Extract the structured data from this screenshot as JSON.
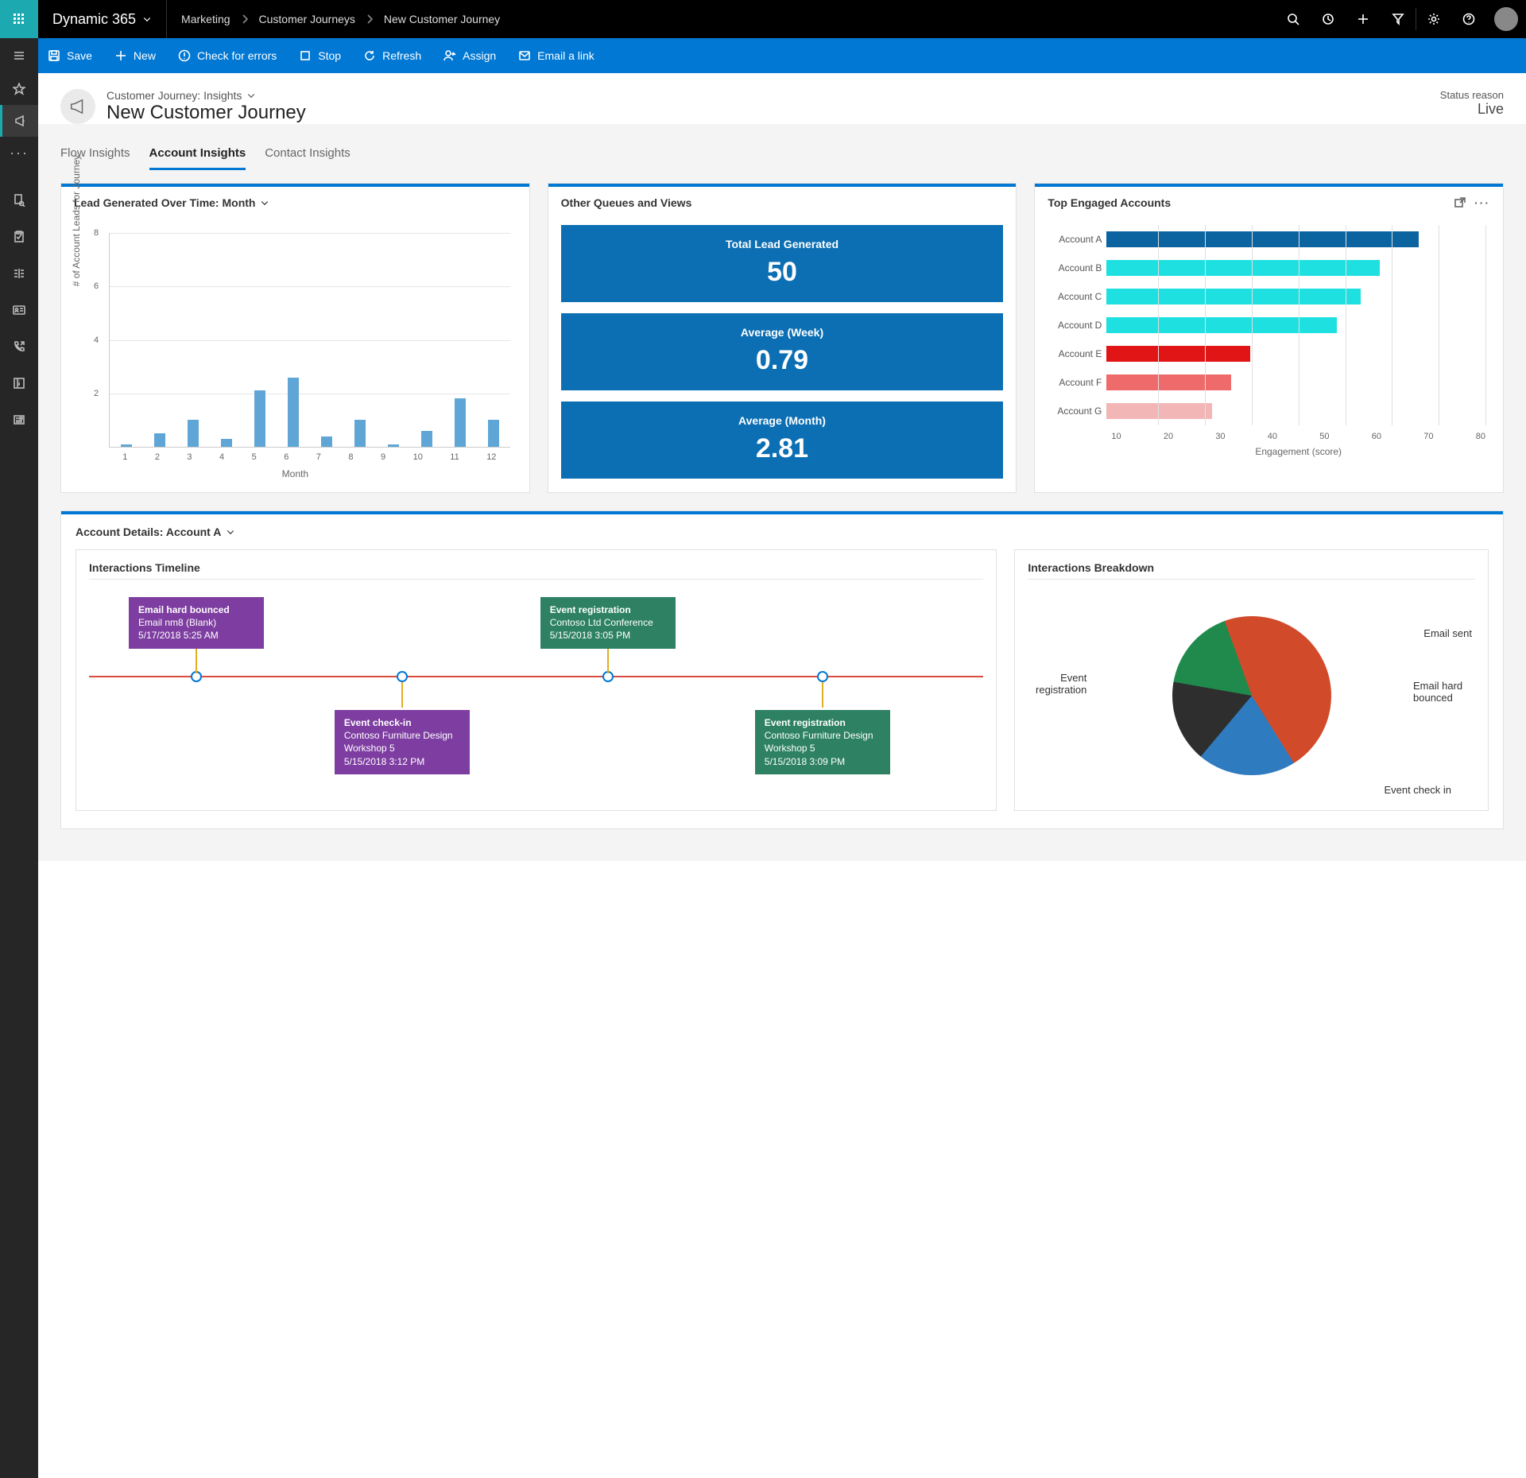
{
  "topbar": {
    "brand": "Dynamic 365",
    "breadcrumbs": [
      "Marketing",
      "Customer Journeys",
      "New Customer Journey"
    ]
  },
  "cmdbar": {
    "save": "Save",
    "new": "New",
    "check": "Check for errors",
    "stop": "Stop",
    "refresh": "Refresh",
    "assign": "Assign",
    "email": "Email a link"
  },
  "record": {
    "sub": "Customer Journey: Insights",
    "title": "New Customer Journey",
    "status_label": "Status reason",
    "status_value": "Live"
  },
  "tabs": {
    "flow": "Flow Insights",
    "account": "Account Insights",
    "contact": "Contact Insights"
  },
  "card1": {
    "title": "Lead Generated Over Time: Month",
    "ylabel": "# of Account Leads for Journey",
    "xlabel": "Month"
  },
  "card2": {
    "title": "Other Queues and Views",
    "kpis": [
      {
        "label": "Total Lead Generated",
        "value": "50"
      },
      {
        "label": "Average (Week)",
        "value": "0.79"
      },
      {
        "label": "Average (Month)",
        "value": "2.81"
      }
    ]
  },
  "card3": {
    "title": "Top Engaged Accounts",
    "xlabel": "Engagement (score)"
  },
  "details": {
    "title": "Account Details: Account A",
    "timeline_title": "Interactions Timeline",
    "breakdown_title": "Interactions Breakdown",
    "events": [
      {
        "pos": 12,
        "side": "up",
        "color": "purple",
        "title": "Email hard bounced",
        "line2": "Email nm8 (Blank)",
        "ts": "5/17/2018 5:25 AM"
      },
      {
        "pos": 35,
        "side": "down",
        "color": "purple",
        "title": "Event check-in",
        "line2": "Contoso Furniture Design Workshop 5",
        "ts": "5/15/2018 3:12 PM"
      },
      {
        "pos": 58,
        "side": "up",
        "color": "green",
        "title": "Event registration",
        "line2": "Contoso Ltd Conference",
        "ts": "5/15/2018 3:05 PM"
      },
      {
        "pos": 82,
        "side": "down",
        "color": "green",
        "title": "Event registration",
        "line2": "Contoso Furniture Design Workshop 5",
        "ts": "5/15/2018 3:09 PM"
      }
    ],
    "pie_labels": {
      "sent": "Email sent",
      "bounced": "Email hard bounced",
      "checkin": "Event check in",
      "reg": "Event registration"
    }
  },
  "chart_data": [
    {
      "type": "bar",
      "title": "Lead Generated Over Time: Month",
      "xlabel": "Month",
      "ylabel": "# of Account Leads for Journey",
      "ylim": [
        0,
        8
      ],
      "categories": [
        "1",
        "2",
        "3",
        "4",
        "5",
        "6",
        "7",
        "8",
        "9",
        "10",
        "11",
        "12"
      ],
      "values": [
        0.1,
        0.5,
        1.0,
        0.3,
        2.1,
        2.6,
        0.4,
        1.0,
        0.1,
        0.6,
        1.8,
        1.0
      ]
    },
    {
      "type": "bar",
      "title": "Top Engaged Accounts",
      "orientation": "horizontal",
      "xlabel": "Engagement (score)",
      "xlim": [
        0,
        80
      ],
      "series": [
        {
          "name": "Account A",
          "value": 65,
          "color": "#0b64a0"
        },
        {
          "name": "Account B",
          "value": 57,
          "color": "#1fe0e0"
        },
        {
          "name": "Account C",
          "value": 53,
          "color": "#1fe0e0"
        },
        {
          "name": "Account D",
          "value": 48,
          "color": "#1fe0e0"
        },
        {
          "name": "Account E",
          "value": 30,
          "color": "#e11515"
        },
        {
          "name": "Account F",
          "value": 26,
          "color": "#ef6a6a"
        },
        {
          "name": "Account G",
          "value": 22,
          "color": "#f3b6b6"
        }
      ],
      "ticks": [
        10,
        20,
        30,
        40,
        50,
        60,
        70,
        80
      ]
    },
    {
      "type": "pie",
      "title": "Interactions Breakdown",
      "slices": [
        {
          "name": "Event registration",
          "value": 42,
          "color": "#d14b2a"
        },
        {
          "name": "Email sent",
          "value": 18,
          "color": "#2f7bbf"
        },
        {
          "name": "Email hard bounced",
          "value": 15,
          "color": "#2e2e2e"
        },
        {
          "name": "Event check in",
          "value": 15,
          "color": "#1f8a4c"
        }
      ]
    }
  ]
}
